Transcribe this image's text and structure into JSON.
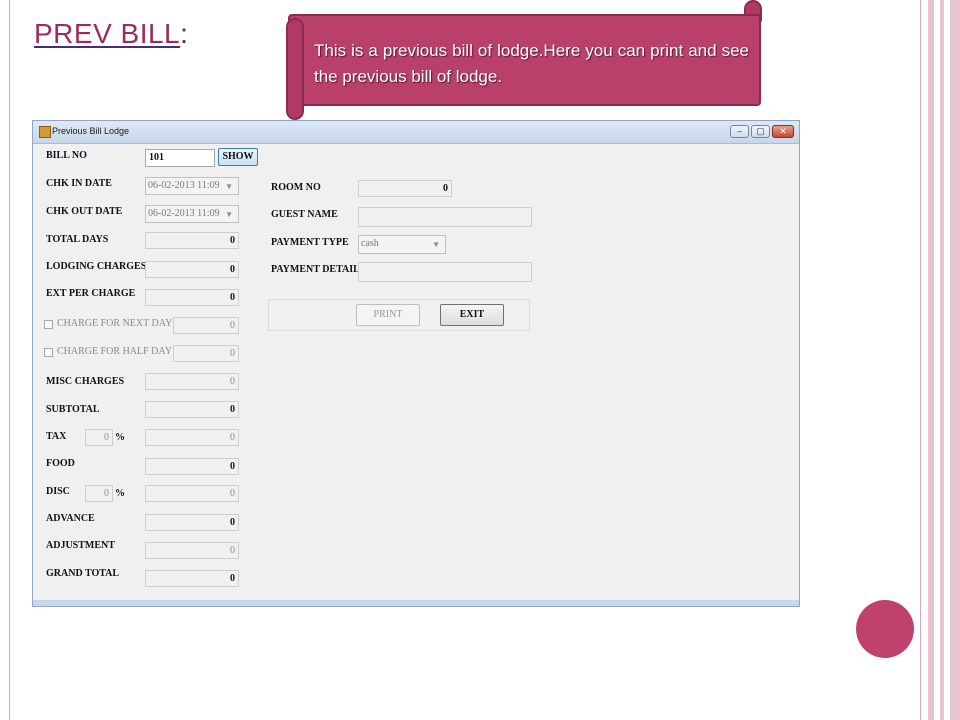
{
  "slide": {
    "title": "PREV BILL",
    "title_colon": ":",
    "callout": "This is a previous bill of lodge.Here you can print and see the previous bill of  lodge."
  },
  "window": {
    "title": "Previous Bill Lodge",
    "controls": {
      "minimize": "–",
      "maximize": "▢",
      "close": "✕"
    }
  },
  "form": {
    "bill_no": {
      "label": "BILL NO",
      "value": "101"
    },
    "show_button": "SHOW",
    "chk_in_date": {
      "label": "CHK IN DATE",
      "value": "06-02-2013 11:09"
    },
    "chk_out_date": {
      "label": "CHK OUT DATE",
      "value": "06-02-2013 11:09"
    },
    "total_days": {
      "label": "TOTAL DAYS",
      "value": "0"
    },
    "lodging_charges": {
      "label": "LODGING CHARGES",
      "value": "0"
    },
    "ext_per_charge": {
      "label": "EXT PER CHARGE",
      "value": "0"
    },
    "charge_next_day": {
      "label": "CHARGE FOR NEXT DAY",
      "value": "0"
    },
    "charge_half_day": {
      "label": "CHARGE FOR HALF DAY",
      "value": "0"
    },
    "misc_charges": {
      "label": "MISC CHARGES",
      "value": "0"
    },
    "subtotal": {
      "label": "SUBTOTAL",
      "value": "0"
    },
    "tax": {
      "label": "TAX",
      "percent": "0",
      "percent_sign": "%",
      "value": "0"
    },
    "food": {
      "label": "FOOD",
      "value": "0"
    },
    "disc": {
      "label": "DISC",
      "percent": "0",
      "percent_sign": "%",
      "value": "0"
    },
    "advance": {
      "label": "ADVANCE",
      "value": "0"
    },
    "adjustment": {
      "label": "ADJUSTMENT",
      "value": "0"
    },
    "grand_total": {
      "label": "GRAND TOTAL",
      "value": "0"
    },
    "room_no": {
      "label": "ROOM NO",
      "value": "0"
    },
    "guest_name": {
      "label": "GUEST NAME",
      "value": ""
    },
    "payment_type": {
      "label": "PAYMENT TYPE",
      "value": "cash"
    },
    "payment_detail": {
      "label": "PAYMENT DETAIL",
      "value": ""
    },
    "print_button": "PRINT",
    "exit_button": "EXIT"
  },
  "colors": {
    "accent": "#b8406a",
    "title_color": "#9b2d5d",
    "window_bg": "#f0f0f0"
  }
}
